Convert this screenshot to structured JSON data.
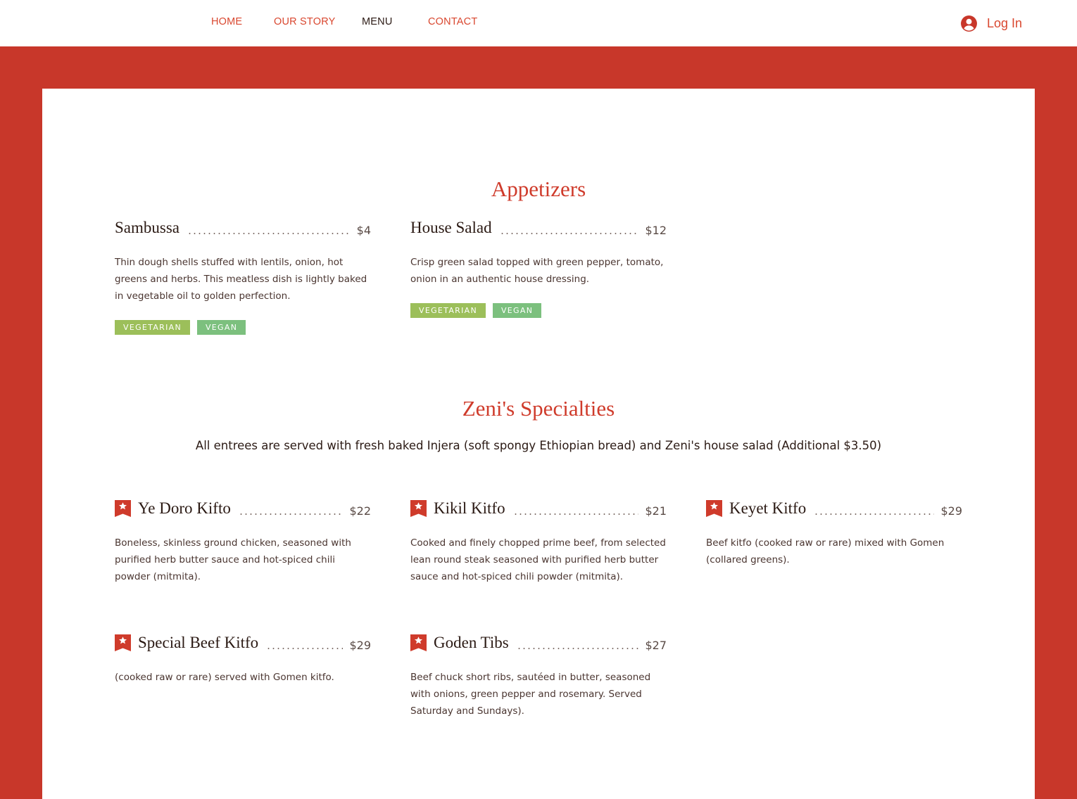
{
  "nav": {
    "home": "HOME",
    "our_story": "OUR STORY",
    "menu": "MENU",
    "contact": "CONTACT",
    "login": "Log In"
  },
  "colors": {
    "brand_red": "#c8372a",
    "title_red": "#cf3b2b",
    "vegetarian_tag": "#9cbf5a",
    "vegan_tag": "#7cc07e"
  },
  "appetizers": {
    "title": "Appetizers",
    "items": [
      {
        "name": "Sambussa",
        "price": "$4",
        "description": "Thin dough shells stuffed with lentils, onion, hot greens and herbs. This meatless dish is lightly baked in vegetable oil to golden perfection.",
        "tags": [
          "VEGETARIAN",
          "VEGAN"
        ]
      },
      {
        "name": "House Salad",
        "price": "$12",
        "description": "Crisp green salad topped with green pepper, tomato, onion in an authentic house dressing.",
        "tags": [
          "VEGETARIAN",
          "VEGAN"
        ]
      }
    ]
  },
  "specialties": {
    "title": "Zeni's Specialties",
    "subtitle": "All entrees are served with fresh baked Injera (soft spongy Ethiopian bread) and Zeni's house salad (Additional $3.50)",
    "badge_icon": "star-badge-icon",
    "items": [
      {
        "name": "Ye Doro Kifto",
        "price": "$22",
        "description": "Boneless, skinless ground chicken, seasoned with purified herb butter sauce and hot-spiced chili powder (mitmita)."
      },
      {
        "name": "Kikil Kitfo",
        "price": "$21",
        "description": "Cooked and finely chopped prime beef, from selected lean round steak seasoned with purified herb butter sauce and hot-spiced chili powder (mitmita)."
      },
      {
        "name": "Keyet Kitfo",
        "price": "$29",
        "description": "Beef kitfo (cooked raw or rare) mixed with Gomen (collared greens)."
      },
      {
        "name": "Special Beef Kitfo",
        "price": "$29",
        "description": "(cooked raw or rare) served with Gomen kitfo."
      },
      {
        "name": "Goden Tibs",
        "price": "$27",
        "description": "Beef chuck short ribs, sautéed in butter, seasoned with onions, green pepper and rosemary. Served Saturday and Sundays)."
      }
    ]
  }
}
